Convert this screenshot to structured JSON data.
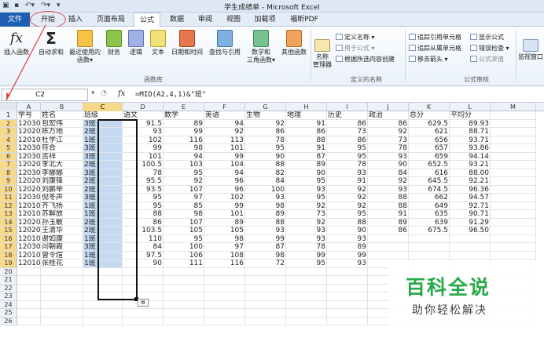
{
  "window": {
    "title": "学生成绩单 - Microsoft Excel",
    "qa_icons": [
      "excel-icon",
      "save-icon",
      "undo-icon",
      "redo-icon",
      "customize-icon"
    ]
  },
  "tabs": [
    {
      "label": "文件"
    },
    {
      "label": "开始"
    },
    {
      "label": "插入"
    },
    {
      "label": "页面布局"
    },
    {
      "label": "公式"
    },
    {
      "label": "数据"
    },
    {
      "label": "审阅"
    },
    {
      "label": "视图"
    },
    {
      "label": "加载项"
    },
    {
      "label": "福昕PDF"
    }
  ],
  "ribbon": {
    "insert_function": "插入函数",
    "autosum": "自动求和",
    "recent": [
      "最近使用的",
      "函数▾"
    ],
    "financial": "财务",
    "logical": "逻辑",
    "text": "文本",
    "datetime": "日期和时间",
    "lookup": "查找与引用",
    "math": [
      "数学和",
      "三角函数▾"
    ],
    "more": "其他函数",
    "group_library": "函数库",
    "name_manager": [
      "名称",
      "管理器"
    ],
    "define_name": "定义名称 ▾",
    "use_in_formula": "用于公式 ▾",
    "create_from_selection": "根据所选内容创建",
    "group_names": "定义的名称",
    "trace_precedents": "追踪引用单元格",
    "trace_dependents": "追踪从属单元格",
    "remove_arrows": "移去箭头 ▾",
    "show_formulas": "显示公式",
    "error_checking": "错误检查 ▾",
    "evaluate_formula": "公式求值",
    "group_audit": "公式审核",
    "watch_window": "监视窗口"
  },
  "formula_bar": {
    "name_box": "C2",
    "fx": "fx",
    "formula": "=MID(A2,4,1)&\"班\""
  },
  "columns": [
    "A",
    "B",
    "C",
    "D",
    "E",
    "F",
    "G",
    "H",
    "I",
    "J",
    "K",
    "L",
    "M"
  ],
  "rows": [
    [
      "学号",
      "姓名",
      "班级",
      "语文",
      "数学",
      "英语",
      "生物",
      "地理",
      "历史",
      "政治",
      "总分",
      "平均分",
      ""
    ],
    [
      "120305",
      "包宏伟",
      "3班",
      "91.5",
      "89",
      "94",
      "92",
      "91",
      "86",
      "86",
      "629.5",
      "89.93",
      ""
    ],
    [
      "120203",
      "陈万地",
      "2班",
      "93",
      "99",
      "92",
      "86",
      "86",
      "73",
      "92",
      "621",
      "88.71",
      ""
    ],
    [
      "120104",
      "杜学江",
      "1班",
      "102",
      "116",
      "113",
      "78",
      "88",
      "86",
      "73",
      "656",
      "93.71",
      ""
    ],
    [
      "120301",
      "符合",
      "3班",
      "99",
      "98",
      "101",
      "95",
      "91",
      "95",
      "78",
      "657",
      "93.86",
      ""
    ],
    [
      "120306",
      "吉祥",
      "3班",
      "101",
      "94",
      "99",
      "90",
      "87",
      "95",
      "93",
      "659",
      "94.14",
      ""
    ],
    [
      "120206",
      "李北大",
      "2班",
      "100.5",
      "103",
      "104",
      "88",
      "89",
      "78",
      "90",
      "652.5",
      "93.21",
      ""
    ],
    [
      "120302",
      "李娜娜",
      "3班",
      "78",
      "95",
      "94",
      "82",
      "90",
      "93",
      "84",
      "616",
      "88.00",
      ""
    ],
    [
      "120204",
      "刘康锋",
      "2班",
      "95.5",
      "92",
      "96",
      "84",
      "95",
      "91",
      "92",
      "645.5",
      "92.21",
      ""
    ],
    [
      "120201",
      "刘鹏举",
      "2班",
      "93.5",
      "107",
      "96",
      "100",
      "93",
      "92",
      "93",
      "674.5",
      "96.36",
      ""
    ],
    [
      "120304",
      "倪冬声",
      "3班",
      "95",
      "97",
      "102",
      "93",
      "95",
      "92",
      "88",
      "662",
      "94.57",
      ""
    ],
    [
      "120103",
      "齐飞扬",
      "1班",
      "95",
      "85",
      "99",
      "98",
      "92",
      "92",
      "88",
      "649",
      "92.71",
      ""
    ],
    [
      "120105",
      "苏解放",
      "1班",
      "88",
      "98",
      "101",
      "89",
      "73",
      "95",
      "91",
      "635",
      "90.71",
      ""
    ],
    [
      "120202",
      "孙玉敏",
      "2班",
      "86",
      "107",
      "89",
      "88",
      "92",
      "88",
      "89",
      "639",
      "91.29",
      ""
    ],
    [
      "120205",
      "王清华",
      "2班",
      "103.5",
      "105",
      "105",
      "93",
      "93",
      "90",
      "86",
      "675.5",
      "96.50",
      ""
    ],
    [
      "120102",
      "谢如康",
      "1班",
      "110",
      "95",
      "98",
      "99",
      "93",
      "93",
      "",
      "",
      "",
      ""
    ],
    [
      "120303",
      "闫朝霞",
      "3班",
      "84",
      "100",
      "97",
      "87",
      "78",
      "89",
      "",
      "",
      "",
      ""
    ],
    [
      "120101",
      "曾令煊",
      "1班",
      "97.5",
      "106",
      "108",
      "98",
      "99",
      "99",
      "",
      "",
      "",
      ""
    ],
    [
      "120106",
      "张桂花",
      "1班",
      "90",
      "111",
      "116",
      "72",
      "95",
      "93",
      "",
      "",
      "",
      ""
    ],
    [
      "",
      "",
      "",
      "",
      "",
      "",
      "",
      "",
      "",
      "",
      "",
      "",
      ""
    ],
    [
      "",
      "",
      "",
      "",
      "",
      "",
      "",
      "",
      "",
      "",
      "",
      "",
      ""
    ],
    [
      "",
      "",
      "",
      "",
      "",
      "",
      "",
      "",
      "",
      "",
      "",
      "",
      ""
    ],
    [
      "",
      "",
      "",
      "",
      "",
      "",
      "",
      "",
      "",
      "",
      "",
      "",
      ""
    ],
    [
      "",
      "",
      "",
      "",
      "",
      "",
      "",
      "",
      "",
      "",
      "",
      "",
      ""
    ],
    [
      "",
      "",
      "",
      "",
      "",
      "",
      "",
      "",
      "",
      "",
      "",
      "",
      ""
    ],
    [
      "",
      "",
      "",
      "",
      "",
      "",
      "",
      "",
      "",
      "",
      "",
      "",
      ""
    ]
  ],
  "watermark": {
    "title": "百科全说",
    "subtitle": "助你轻松解决"
  }
}
